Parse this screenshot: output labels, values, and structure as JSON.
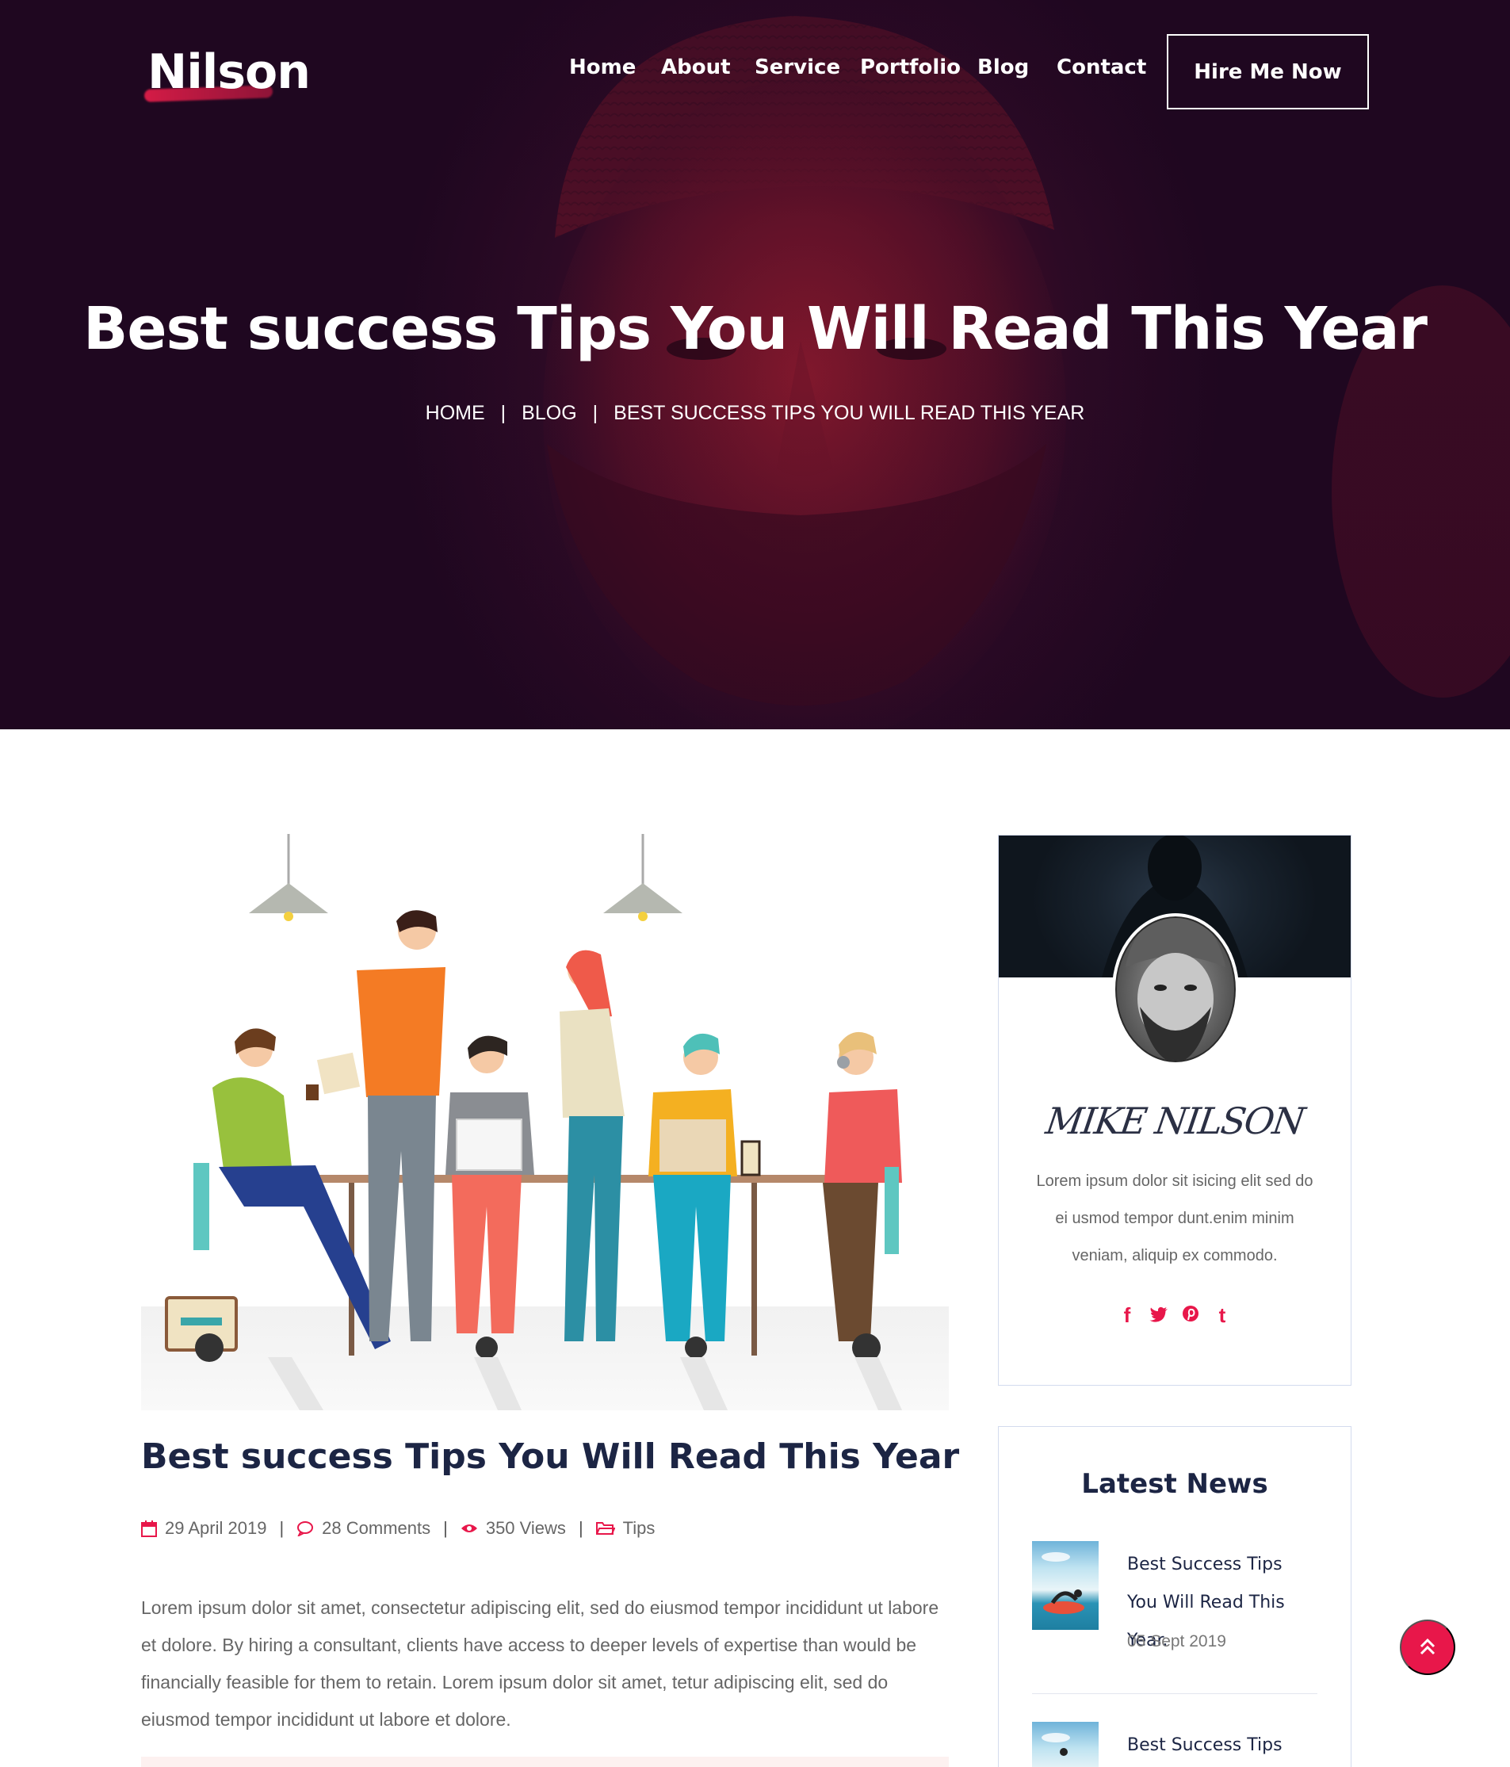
{
  "header": {
    "logo": "Nilson",
    "nav": [
      "Home",
      "About",
      "Service",
      "Portfolio",
      "Blog",
      "Contact"
    ],
    "cta": "Hire Me Now"
  },
  "hero": {
    "title": "Best success Tips You Will Read This Year",
    "breadcrumb": [
      "HOME",
      "BLOG",
      "BEST SUCCESS TIPS YOU WILL READ THIS YEAR"
    ],
    "breadcrumb_separator": "|"
  },
  "post": {
    "title": "Best success Tips You Will Read This Year",
    "date": "29 April 2019",
    "comments": "28 Comments",
    "views": "350 Views",
    "category": "Tips",
    "meta_separator": "|",
    "excerpt": "Lorem ipsum dolor sit amet, consectetur adipiscing elit, sed do eiusmod tempor incididunt ut labore et dolore. By hiring a consultant, clients have access to deeper levels of expertise than would be financially feasible for them to retain. Lorem ipsum dolor sit amet, tetur adipiscing elit, sed do eiusmod tempor incididunt ut labore et dolore."
  },
  "sidebar": {
    "author": {
      "signature": "MIKE NILSON",
      "bio": "Lorem ipsum dolor sit isicing elit sed do ei usmod tempor dunt.enim minim veniam, aliquip ex commodo.",
      "social": [
        "f",
        "t",
        "p",
        "t"
      ]
    },
    "latest_news": {
      "heading": "Latest News",
      "items": [
        {
          "title": "Best Success Tips You Will Read This Year.",
          "date": "05 Sept 2019"
        },
        {
          "title": "Best Success Tips You",
          "date": ""
        }
      ]
    }
  },
  "icons": {
    "calendar": "calendar-icon",
    "comment": "comment-icon",
    "eye": "eye-icon",
    "folder": "folder-icon",
    "scroll_top": "double-chevron-up-icon"
  },
  "colors": {
    "accent": "#e8174a",
    "hero_dark": "#2c0a25",
    "heading": "#1c2544",
    "border": "#d3dbee"
  }
}
